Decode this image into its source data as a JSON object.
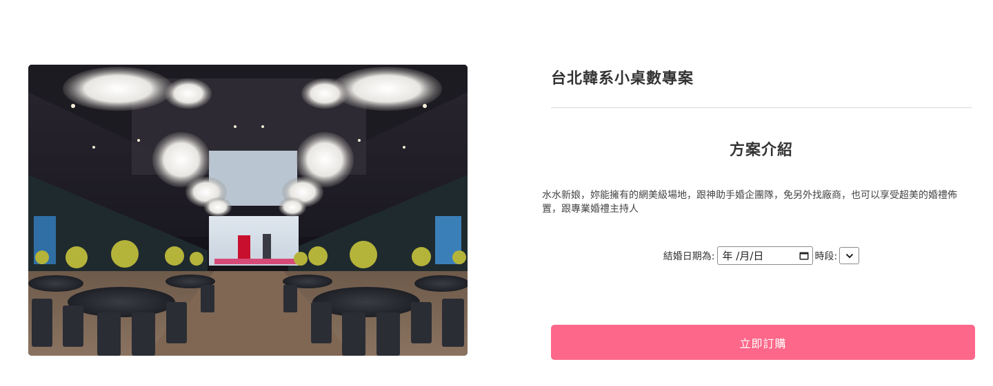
{
  "product": {
    "image_alt": "宴會廳",
    "title": "台北韓系小桌數專案"
  },
  "intro": {
    "heading": "方案介紹",
    "description": "水水新娘，妳能擁有的網美級場地，跟神助手婚企團隊，免另外找廠商，也可以享受超美的婚禮佈置，跟專業婚禮主持人"
  },
  "booking": {
    "date_label": "結婚日期為:",
    "date_placeholder": "年 /月/日",
    "period_label": "時段:",
    "period_selected": ""
  },
  "cta": {
    "label": "立即訂購",
    "color": "#fd6789"
  },
  "icons": {
    "calendar": "calendar-icon",
    "dropdown": "chevron-down-icon"
  }
}
